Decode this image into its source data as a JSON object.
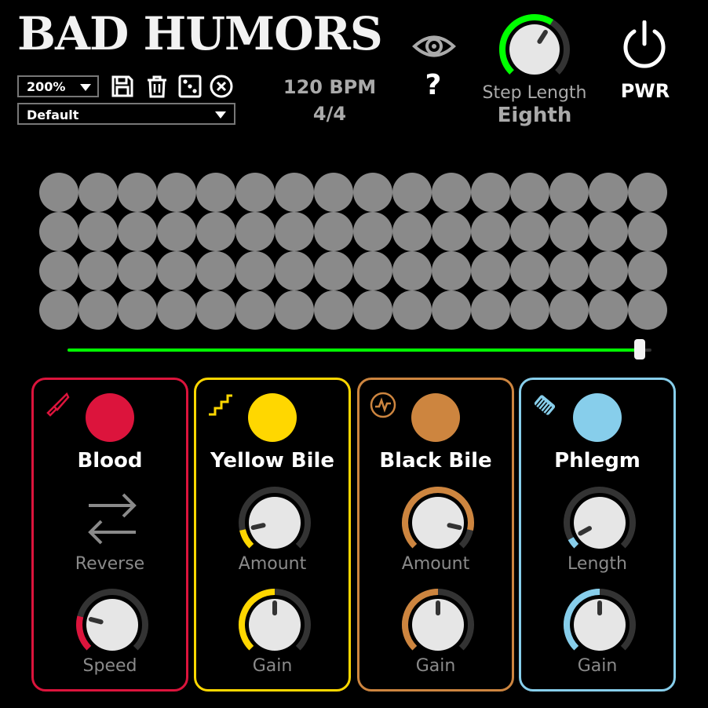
{
  "header": {
    "title": "BAD HUMORS",
    "zoom": "200%",
    "preset": "Default",
    "tempo": "120 BPM",
    "time_signature": "4/4",
    "help_label": "?",
    "step_length_label": "Step Length",
    "step_length_value": "Eighth",
    "power_label": "PWR",
    "toolbar_icons": [
      "save-icon",
      "trash-icon",
      "dice-icon",
      "close-icon"
    ]
  },
  "sequencer": {
    "rows": 4,
    "columns": 16,
    "playhead_progress": 0.98
  },
  "panels": [
    {
      "id": "blood",
      "title": "Blood",
      "color": "#dc143c",
      "icon": "knife-icon",
      "control1_label": "Reverse",
      "control2_label": "Speed",
      "speed_level": 0.22
    },
    {
      "id": "yellow-bile",
      "title": "Yellow Bile",
      "color": "#ffd700",
      "icon": "stairs-icon",
      "control1_label": "Amount",
      "control2_label": "Gain",
      "amount_level": 0.12,
      "gain_level": 0.5
    },
    {
      "id": "black-bile",
      "title": "Black Bile",
      "color": "#cd853f",
      "icon": "wave-icon",
      "control1_label": "Amount",
      "control2_label": "Gain",
      "amount_level": 0.88,
      "gain_level": 0.5
    },
    {
      "id": "phlegm",
      "title": "Phlegm",
      "color": "#87ceeb",
      "icon": "comb-icon",
      "control1_label": "Length",
      "control2_label": "Gain",
      "length_level": 0.06,
      "gain_level": 0.5
    }
  ],
  "colors": {
    "active_green": "#00ff00",
    "cell_gray": "#8a8a8a"
  },
  "step_length_level": 0.62
}
